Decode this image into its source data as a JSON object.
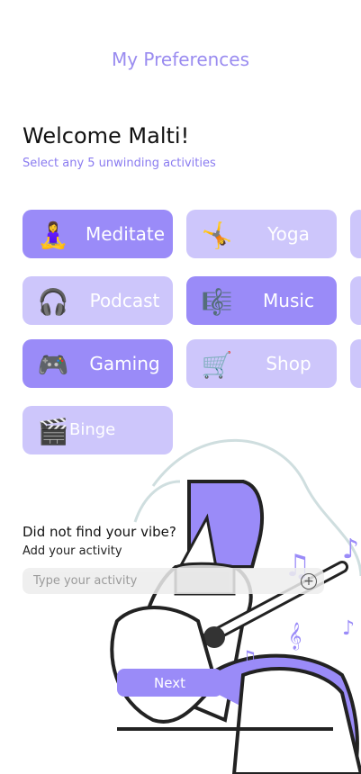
{
  "header": {
    "title": "My Preferences"
  },
  "greeting": {
    "welcome": "Welcome Malti!",
    "instruction": "Select any 5 unwinding activities"
  },
  "activities": [
    {
      "label": "Meditate",
      "emoji": "🧘‍♀️",
      "selected": true
    },
    {
      "label": "Yoga",
      "emoji": "🤸",
      "selected": false
    },
    {
      "label": "Podcast",
      "emoji": "🎧",
      "selected": false
    },
    {
      "label": "Music",
      "emoji": "🎼",
      "selected": true
    },
    {
      "label": "Gaming",
      "emoji": "🎮",
      "selected": true
    },
    {
      "label": "Shop",
      "emoji": "🛒",
      "selected": false
    },
    {
      "label": "Binge Watch",
      "emoji": "🎬",
      "selected": false
    }
  ],
  "custom": {
    "heading": "Did not find your vibe?",
    "subheading": "Add your activity",
    "placeholder": "Type your activity",
    "add_symbol": "+"
  },
  "footer": {
    "next_label": "Next"
  },
  "colors": {
    "accent": "#9a8bf8",
    "accent_light": "#cdc6fb",
    "title": "#9a8cf0"
  }
}
